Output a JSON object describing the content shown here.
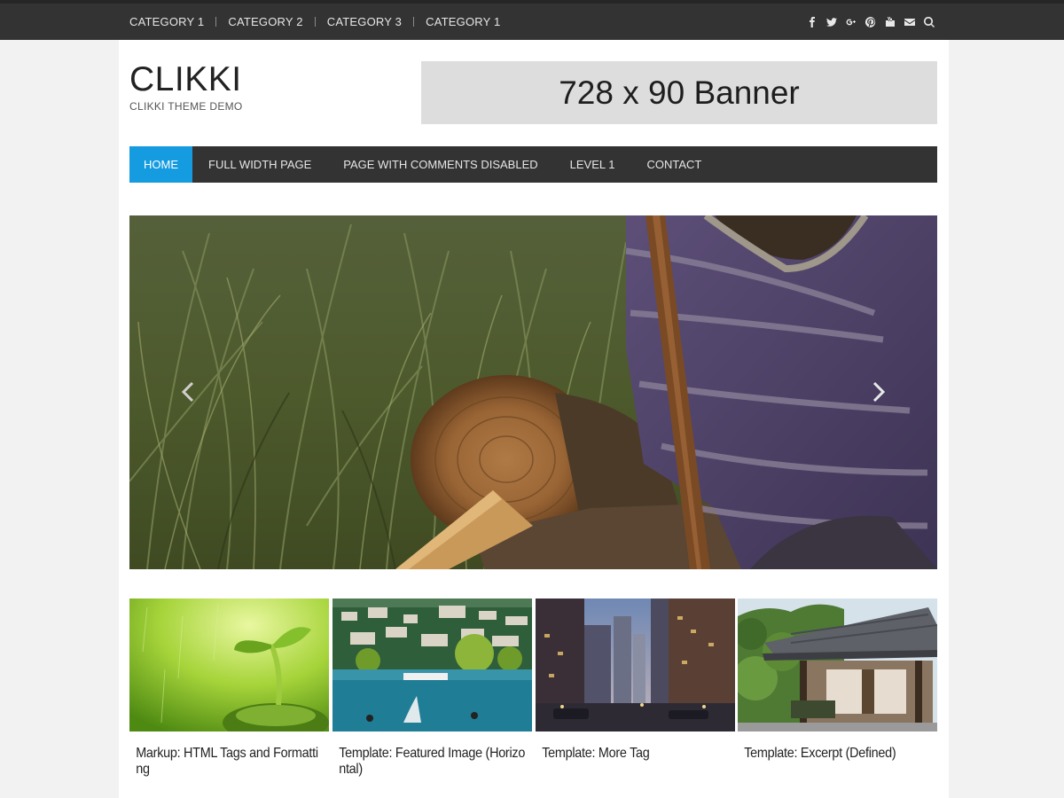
{
  "topbar": {
    "categories": [
      "CATEGORY 1",
      "CATEGORY 2",
      "CATEGORY 3",
      "CATEGORY 1"
    ],
    "social_icons": [
      "facebook-icon",
      "twitter-icon",
      "google-plus-icon",
      "pinterest-icon",
      "youtube-icon",
      "email-icon",
      "search-icon"
    ],
    "background": "#333333"
  },
  "header": {
    "site_title": "CLIKKI",
    "site_description": "CLIKKI THEME DEMO",
    "banner_text": "728 x 90 Banner"
  },
  "nav": {
    "items": [
      "HOME",
      "FULL WIDTH PAGE",
      "PAGE WITH COMMENTS DISABLED",
      "LEVEL 1",
      "CONTACT"
    ],
    "active_index": 0,
    "accent": "#159be0"
  },
  "slider": {
    "prev_icon": "chevron-left-icon",
    "next_icon": "chevron-right-icon"
  },
  "posts": [
    {
      "title": "Markup: HTML Tags and Formatting"
    },
    {
      "title": "Template: Featured Image (Horizontal)"
    },
    {
      "title": "Template: More Tag"
    },
    {
      "title": "Template: Excerpt (Defined)"
    }
  ]
}
